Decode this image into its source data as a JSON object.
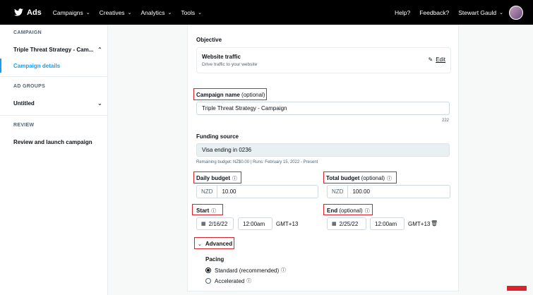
{
  "topbar": {
    "brand": "Ads",
    "nav": [
      "Campaigns",
      "Creatives",
      "Analytics",
      "Tools"
    ],
    "help": "Help?",
    "feedback": "Feedback?",
    "user": "Stewart Gauld"
  },
  "sidebar": {
    "campaign_heading": "CAMPAIGN",
    "campaign_name": "Triple Threat Strategy - Cam...",
    "campaign_details": "Campaign details",
    "adgroups_heading": "AD GROUPS",
    "adgroup_name": "Untitled",
    "review_heading": "REVIEW",
    "review_item": "Review and launch campaign"
  },
  "form": {
    "objective_label": "Objective",
    "objective_title": "Website traffic",
    "objective_desc": "Drive traffic to your website",
    "edit": "Edit",
    "campaign_name_label": "Campaign name",
    "optional": "(optional)",
    "campaign_name_value": "Triple Threat Strategy - Campaign",
    "char_count": "222",
    "funding_label": "Funding source",
    "funding_value": "Visa ending in 0236",
    "funding_note": "Remaining budget: NZ$0.00 | Runs: February 15, 2022 - Present",
    "daily_budget_label": "Daily budget",
    "total_budget_label": "Total budget",
    "currency": "NZD",
    "daily_value": "10.00",
    "total_value": "100.00",
    "start_label": "Start",
    "end_label": "End",
    "start_date": "2/16/22",
    "start_time": "12:00am",
    "end_date": "2/25/22",
    "end_time": "12:00am",
    "timezone": "GMT+13",
    "advanced": "Advanced",
    "pacing_label": "Pacing",
    "standard": "Standard (recommended)",
    "accelerated": "Accelerated"
  },
  "colors": {
    "accent": "#1d9bf0",
    "highlight": "#d9232d"
  }
}
